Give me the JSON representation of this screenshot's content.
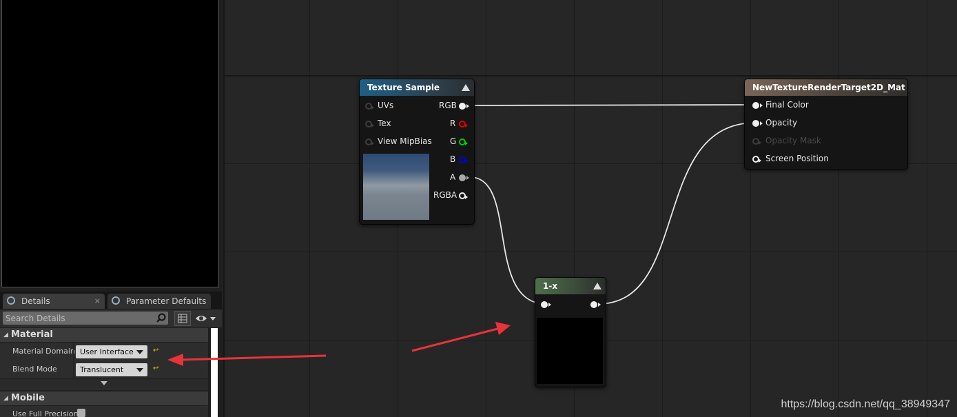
{
  "details_panel": {
    "tabs": [
      {
        "label": "Details",
        "close": "×"
      },
      {
        "label": "Parameter Defaults",
        "close": ""
      }
    ],
    "search": {
      "placeholder": "Search Details"
    },
    "categories": {
      "material": {
        "label": "Material",
        "properties": [
          {
            "label": "Material Domain",
            "value": "User Interface"
          },
          {
            "label": "Blend Mode",
            "value": "Translucent"
          }
        ]
      },
      "mobile": {
        "label": "Mobile",
        "properties": [
          {
            "label": "Use Full Precision",
            "checked": false
          }
        ]
      }
    },
    "reset_icon": "reset-to-default-icon"
  },
  "graph": {
    "nodes": {
      "texture_sample": {
        "title": "Texture Sample",
        "header_color": "#1e5f86",
        "inputs": [
          "UVs",
          "Tex",
          "View MipBias"
        ],
        "outputs": [
          "RGB",
          "R",
          "G",
          "B",
          "A",
          "RGBA"
        ]
      },
      "one_minus": {
        "title": "1-x",
        "header_color": "#4f6f4a"
      },
      "result": {
        "title": "NewTextureRenderTarget2D_Mat",
        "header_color": "#7a6657",
        "inputs": [
          "Final Color",
          "Opacity",
          "Opacity Mask",
          "Screen Position"
        ]
      }
    }
  },
  "watermark": "https://blog.csdn.net/qq_38949347"
}
